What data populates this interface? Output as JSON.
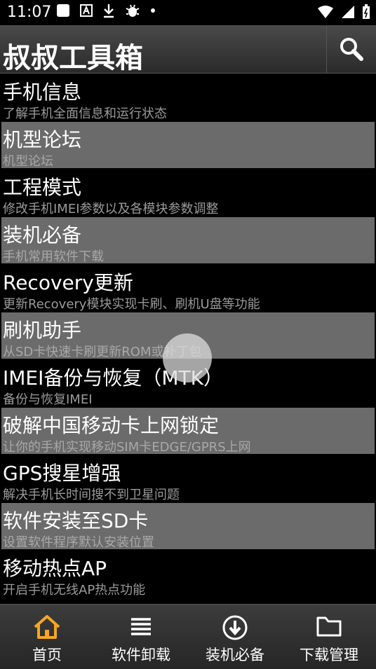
{
  "status": {
    "time": "11:07"
  },
  "header": {
    "title": "叔叔工具箱"
  },
  "items": [
    {
      "title": "手机信息",
      "sub": "了解手机全面信息和运行状态"
    },
    {
      "title": "机型论坛",
      "sub": "机型论坛"
    },
    {
      "title": "工程模式",
      "sub": "修改手机IMEI参数以及各模块参数调整"
    },
    {
      "title": "装机必备",
      "sub": "手机常用软件下载"
    },
    {
      "title": "Recovery更新",
      "sub": "更新Recovery模块实现卡刷、刷机U盘等功能"
    },
    {
      "title": "刷机助手",
      "sub": "从SD卡快速卡刷更新ROM或补丁包"
    },
    {
      "title": "IMEI备份与恢复（MTK）",
      "sub": "备份与恢复IMEI"
    },
    {
      "title": "破解中国移动卡上网锁定",
      "sub": "让你的手机实现移动SIM卡EDGE/GPRS上网"
    },
    {
      "title": "GPS搜星增强",
      "sub": "解决手机长时间搜不到卫星问题"
    },
    {
      "title": "软件安装至SD卡",
      "sub": "设置软件程序默认安装位置"
    },
    {
      "title": "移动热点AP",
      "sub": "开启手机无线AP热点功能"
    }
  ],
  "nav": [
    {
      "label": "首页",
      "icon": "home-icon",
      "active": true
    },
    {
      "label": "软件卸载",
      "icon": "list-icon"
    },
    {
      "label": "装机必备",
      "icon": "download-circle-icon"
    },
    {
      "label": "下载管理",
      "icon": "folder-icon"
    }
  ],
  "colors": {
    "accent": "#f5a623",
    "item_light": "#6b6b6b",
    "item_dark": "#000000"
  }
}
